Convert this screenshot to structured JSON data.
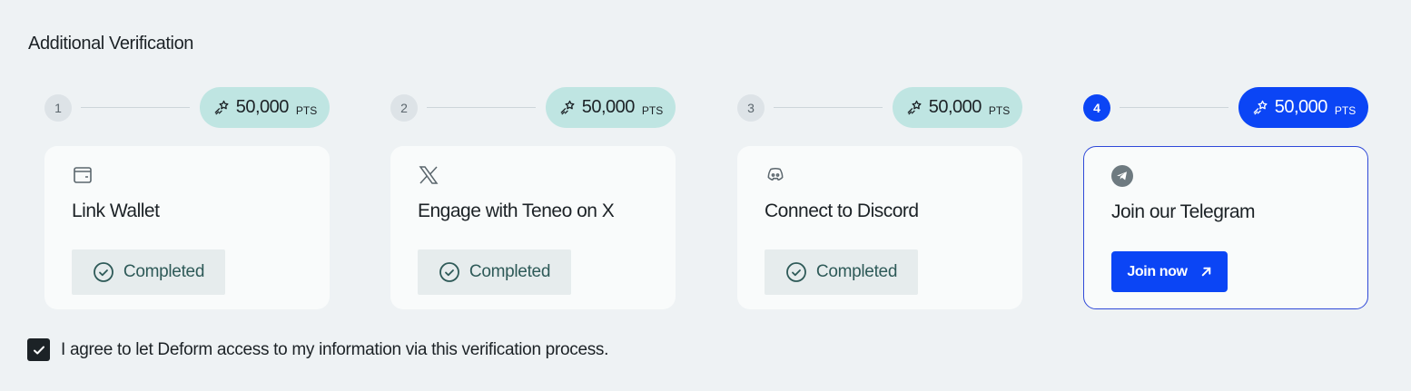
{
  "section": {
    "title": "Additional Verification"
  },
  "steps": [
    {
      "number": "1",
      "points": "50,000",
      "unit": "PTS",
      "title": "Link Wallet",
      "icon": "wallet-icon",
      "status": "Completed"
    },
    {
      "number": "2",
      "points": "50,000",
      "unit": "PTS",
      "title": "Engage with Teneo on X",
      "icon": "x-logo-icon",
      "status": "Completed"
    },
    {
      "number": "3",
      "points": "50,000",
      "unit": "PTS",
      "title": "Connect to Discord",
      "icon": "discord-icon",
      "status": "Completed"
    },
    {
      "number": "4",
      "points": "50,000",
      "unit": "PTS",
      "title": "Join our Telegram",
      "icon": "telegram-icon",
      "action": "Join now"
    }
  ],
  "consent": {
    "checked": true,
    "text": "I agree to let Deform access to my information via this verification process."
  },
  "colors": {
    "accent": "#0b45f5",
    "badge_bg": "#bfe5e2",
    "completed_text": "#2e5a58",
    "page_bg": "#eef2f4"
  }
}
